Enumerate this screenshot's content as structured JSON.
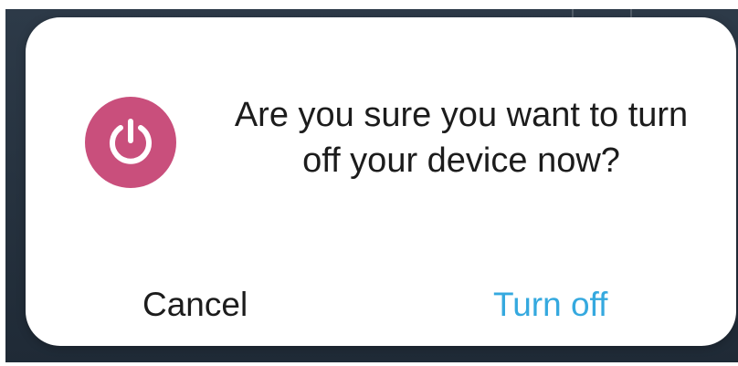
{
  "dialog": {
    "message": "Are you sure you want to turn off your device now?",
    "icon": "power-icon",
    "icon_color": "#c94f7c",
    "cancel_label": "Cancel",
    "confirm_label": "Turn off",
    "confirm_color": "#35a9df"
  }
}
